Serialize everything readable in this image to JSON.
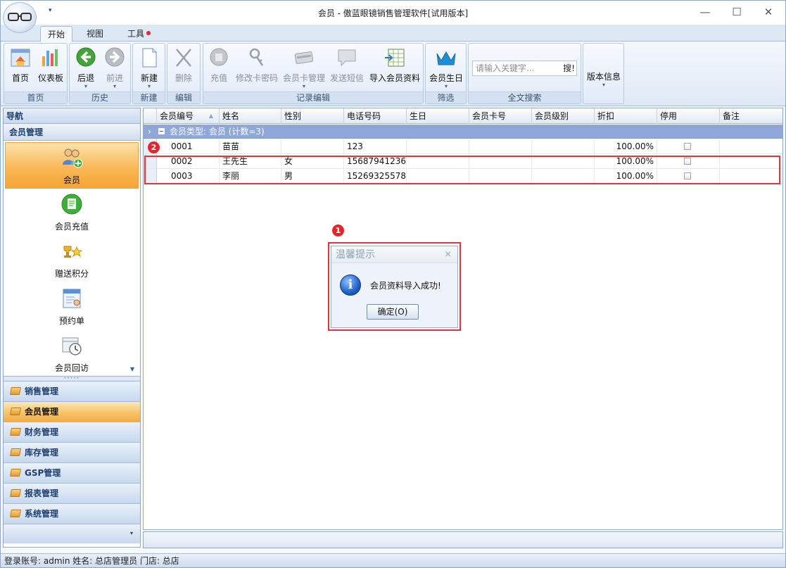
{
  "window": {
    "title": "会员 - 傲蓝眼镜销售管理软件[试用版本]",
    "qa_arrow": "▾",
    "min": "—",
    "max": "☐",
    "close": "✕"
  },
  "ribbon_tabs": [
    {
      "label": "开始",
      "active": true
    },
    {
      "label": "视图",
      "active": false
    },
    {
      "label": "工具",
      "active": false,
      "notification_dot": true
    }
  ],
  "ribbon": {
    "groups": {
      "home": "首页",
      "history": "历史",
      "new": "新建",
      "edit": "编辑",
      "records": "记录编辑",
      "filter": "筛选",
      "fulltext": "全文搜索",
      "about": ""
    },
    "buttons": {
      "home": "首页",
      "dashboard": "仪表板",
      "back": "后退",
      "forward": "前进",
      "new": "新建",
      "delete": "删除",
      "recharge": "充值",
      "change_card_pwd": "修改卡密码",
      "card_manage": "会员卡管理",
      "send_sms": "发送短信",
      "import_members": "导入会员资料",
      "member_birthday": "会员生日",
      "version_info": "版本信息"
    },
    "drop_arrow": "▾",
    "search": {
      "placeholder": "请输入关键字...",
      "button": "搜!"
    }
  },
  "nav": {
    "header": "导航",
    "section": "会员管理",
    "items": [
      {
        "label": "会员",
        "icon": "members-icon",
        "selected": true
      },
      {
        "label": "会员充值",
        "icon": "recharge-icon",
        "selected": false
      },
      {
        "label": "赠送积分",
        "icon": "gift-points-icon",
        "selected": false
      },
      {
        "label": "预约单",
        "icon": "appointment-icon",
        "selected": false
      },
      {
        "label": "会员回访",
        "icon": "followup-icon",
        "selected": false
      }
    ],
    "scroll_arrow": "▼",
    "splitter": "•••••",
    "groups": [
      {
        "label": "销售管理",
        "selected": false
      },
      {
        "label": "会员管理",
        "selected": true
      },
      {
        "label": "财务管理",
        "selected": false
      },
      {
        "label": "库存管理",
        "selected": false
      },
      {
        "label": "GSP管理",
        "selected": false
      },
      {
        "label": "报表管理",
        "selected": false
      },
      {
        "label": "系统管理",
        "selected": false
      }
    ],
    "footer_arrow": "▾"
  },
  "grid": {
    "columns": [
      "会员编号",
      "姓名",
      "性别",
      "电话号码",
      "生日",
      "会员卡号",
      "会员级别",
      "折扣",
      "停用",
      "备注"
    ],
    "sort_arrow": "▲",
    "group_arrow": "›",
    "group_row": "会员类型: 会员 (计数=3)",
    "rows": [
      {
        "id": "0001",
        "name": "苗苗",
        "gender": "",
        "phone": "123",
        "birthday": "",
        "card": "",
        "level": "",
        "discount": "100.00%",
        "disabled": false,
        "note": ""
      },
      {
        "id": "0002",
        "name": "王先生",
        "gender": "女",
        "phone": "15687941236",
        "birthday": "",
        "card": "",
        "level": "",
        "discount": "100.00%",
        "disabled": false,
        "note": ""
      },
      {
        "id": "0003",
        "name": "李丽",
        "gender": "男",
        "phone": "15269325578",
        "birthday": "",
        "card": "",
        "level": "",
        "discount": "100.00%",
        "disabled": false,
        "note": ""
      }
    ]
  },
  "annotations": {
    "badge1": "1",
    "badge2": "2"
  },
  "dialog": {
    "title": "温馨提示",
    "close": "×",
    "icon_glyph": "i",
    "message": "会员资料导入成功!",
    "ok": "确定(O)"
  },
  "status": "登录账号: admin  姓名: 总店管理员  门店: 总店",
  "colors": {
    "accent": "#f9b552",
    "header_blue": "#8fa8d7",
    "annotation_red": "#e0353c"
  }
}
